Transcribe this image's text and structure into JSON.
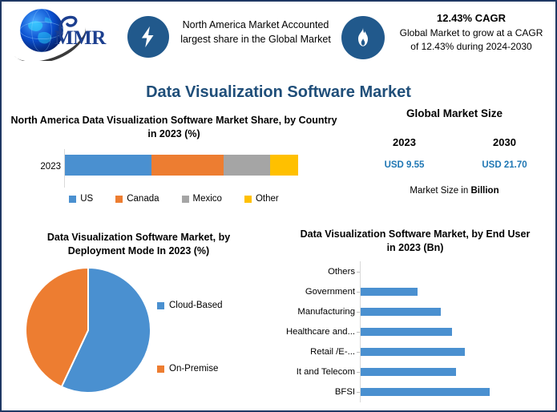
{
  "frame": {
    "border_color": "#1f3864",
    "background": "#ffffff"
  },
  "header": {
    "logo": {
      "name": "MMR",
      "text": "MMR",
      "icon": "globe-icon"
    },
    "items": [
      {
        "icon": "lightning-bolt-icon",
        "icon_bg": "#21598c",
        "text": "North America Market Accounted largest share in the Global Market"
      },
      {
        "icon": "flame-icon",
        "icon_bg": "#21598c",
        "headline": "12.43% CAGR",
        "text": "Global Market to grow at a CAGR of 12.43% during 2024-2030"
      }
    ]
  },
  "main_title": "Data Visualization Software Market",
  "global_market_size": {
    "title": "Global Market Size",
    "year_start": "2023",
    "year_end": "2030",
    "value_start": "USD 9.55",
    "value_end": "USD 21.70",
    "footer_prefix": "Market Size in ",
    "footer_bold": "Billion",
    "value_color": "#1f77b4"
  },
  "chart_data": [
    {
      "id": "north-america-share",
      "type": "bar",
      "orientation": "horizontal-stacked",
      "title": "North America Data Visualization Software Market Share, by Country in 2023 (%)",
      "categories": [
        "2023"
      ],
      "series": [
        {
          "name": "US",
          "values": [
            37
          ],
          "color": "#4a90d0"
        },
        {
          "name": "Canada",
          "values": [
            31
          ],
          "color": "#ed7d31"
        },
        {
          "name": "Mexico",
          "values": [
            20
          ],
          "color": "#a5a5a5"
        },
        {
          "name": "Other",
          "values": [
            12
          ],
          "color": "#ffc000"
        }
      ],
      "legend_position": "bottom",
      "xlabel": "",
      "ylabel": "",
      "grid": false
    },
    {
      "id": "deployment-mode",
      "type": "pie",
      "title": "Data Visualization Software Market, by Deployment Mode In 2023 (%)",
      "labels": [
        "Cloud-Based",
        "On-Premise"
      ],
      "values": [
        57,
        43
      ],
      "colors": [
        "#4a90d0",
        "#ed7d31"
      ],
      "legend_position": "right"
    },
    {
      "id": "end-user",
      "type": "bar",
      "orientation": "horizontal",
      "title": "Data Visualization Software Market, by End User in 2023 (Bn)",
      "categories": [
        "Others",
        "Government",
        "Manufacturing",
        "Healthcare and...",
        "Retail /E-...",
        "It and Telecom",
        "BFSI"
      ],
      "values": [
        0,
        0.44,
        0.62,
        0.71,
        0.81,
        0.74,
        1.0
      ],
      "bar_color": "#4a90d0",
      "xlabel": "",
      "ylabel": "",
      "grid": false,
      "legend_position": "none"
    }
  ]
}
